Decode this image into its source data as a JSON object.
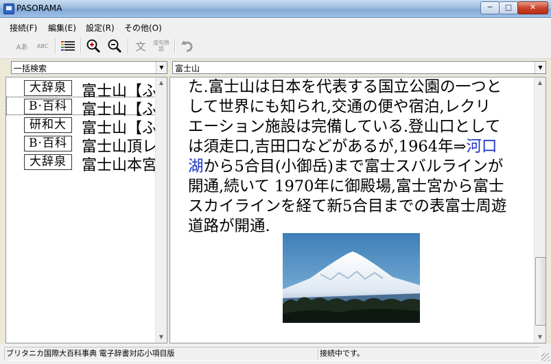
{
  "window": {
    "title": "PASORAMA",
    "min": "─",
    "max": "□",
    "close": "✕"
  },
  "menu": [
    {
      "label": "接続(F)"
    },
    {
      "label": "編集(E)"
    },
    {
      "label": "設定(R)"
    },
    {
      "label": "その他(O)"
    }
  ],
  "toolbar": {
    "icons": [
      "font-size-small-icon",
      "abc-text-icon",
      "color-palette-icon",
      "zoom-in-icon",
      "zoom-out-icon",
      "translate-icon",
      "idiom-icon",
      "jump-back-icon"
    ],
    "tb1": "Aあ",
    "tb2": "ABC",
    "tb6": "文",
    "tb7": "成句熟語"
  },
  "search": {
    "mode": "一括検索",
    "query": "富士山"
  },
  "results": [
    {
      "dict": "大辞泉",
      "entry": "富士山【ふじさん】"
    },
    {
      "dict": "B·百科",
      "entry": "富士山【ふじさん】"
    },
    {
      "dict": "研和大",
      "entry": "富士山【ふじさん】"
    },
    {
      "dict": "B·百科",
      "entry": "富士山頂レーダー"
    },
    {
      "dict": "大辞泉",
      "entry": "富士山本宮浅間大社"
    }
  ],
  "article": {
    "l1": "た.富士山は日本を代表する国立公園の一つと",
    "l2": "して世界にも知られ,交通の便や宿泊,レクリ",
    "l3": "エーション施設は完備している.登山口として",
    "l4a": "は須走口,吉田口などがあるが,1964年⇒",
    "l4link": "河口",
    "l5link": "湖",
    "l5b": "から5合目(小御岳)まで富士スバルラインが",
    "l6": "開通,続いて 1970年に御殿場,富士宮から富士",
    "l7": "スカイラインを経て新5合目までの表富士周遊",
    "l8": "道路が開通."
  },
  "status": {
    "dictionary": "ブリタニカ国際大百科事典 電子辞書対応小項目版",
    "connection": "接続中です。"
  },
  "colors": {
    "link": "#1a32c8",
    "close_button": "#c9452a"
  }
}
